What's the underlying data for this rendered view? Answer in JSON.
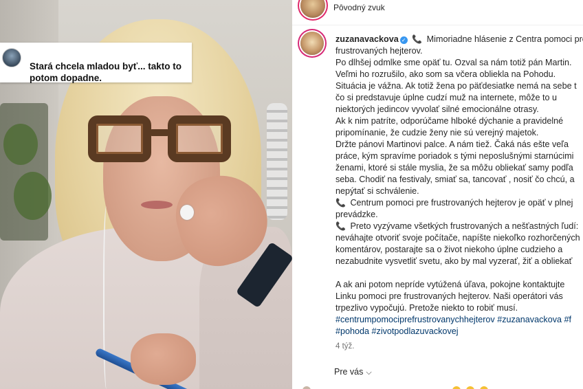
{
  "video": {
    "sticker_text": "Stará chcela mladou byť... takto to potom dopadne."
  },
  "panel": {
    "audio_label": "Pôvodný zvuk",
    "username": "zuzanavackova",
    "caption_lines": [
      "Mimoriadne hlásenie z Centra pomoci pre",
      "frustrovaných hejterov.",
      "Po dlhšej odmlke sme opäť tu. Ozval sa nám totiž pán Martin.",
      "Veľmi ho rozrušilo, ako som sa včera obliekla na Pohodu.",
      "Situácia je vážna. Ak totiž žena po päťdesiatke nemá na sebe t",
      "čo si predstavuje úplne cudzí muž na internete, môže to u",
      "niektorých jedincov vyvolať silné emocionálne otrasy.",
      "Ak k nim patríte, odporúčame hlboké dýchanie a pravidelné",
      "pripomínanie, že cudzie ženy nie sú verejný majetok.",
      "Držte pánovi Martinovi palce. A nám tiež. Čaká nás ešte veľa",
      "práce, kým spravíme poriadok s tými neposlušnými starnúcimi",
      "ženami, ktoré si stále myslia, že sa môžu obliekať samy podľa",
      "seba. Chodiť na festivaly, smiať sa, tancovať , nosiť čo chcú, a",
      "nepýtať si schválenie.",
      "Centrum pomoci pre frustrovaných hejterov je opäť v plnej",
      "prevádzke.",
      "Preto vyzývame všetkých frustrovaných a nešťastných ľudí:",
      "neváhajte otvoriť svoje počítače, napíšte niekoľko rozhorčených",
      "komentárov, postarajte sa o život niekoho úplne cudzieho a",
      "nezabudnite vysvetliť svetu, ako by mal vyzerať, žiť a obliekať",
      "A ak ani potom nepríde vytúžená úľava, pokojne kontaktujte",
      "Linku pomoci pre frustrovaných hejterov. Naši operátori vás",
      "trpezlivo vypočujú. Pretože niekto to robiť musí."
    ],
    "hashtags_line1": "#centrumpomociprefrustrovanychhejterov #zuzanavackova #f",
    "hashtags_line2": "#pohoda #zivotpodlazuvackovej",
    "time_ago": "4 týž.",
    "for_you": "Pre vás",
    "colors": {
      "link": "#00376b",
      "verified": "#3897f0",
      "ring": "#d62976"
    },
    "icons": [
      "verified-icon",
      "telephone-receiver-icon",
      "chevron-down-icon"
    ]
  }
}
